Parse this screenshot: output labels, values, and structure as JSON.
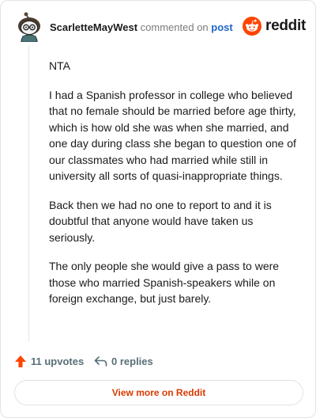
{
  "header": {
    "author": "ScarletteMayWest",
    "commented_text": "commented on",
    "post_link": "post",
    "logo_text": "reddit"
  },
  "comment": {
    "paragraphs": [
      "NTA",
      "I had a Spanish professor in college who believed that no female should be married before age thirty, which is how old she was when she married, and one day during class she began to question one of our classmates who had married while still in university all sorts of quasi-inappropriate things.",
      "Back then we had no one to report to and it is doubtful that anyone would have taken us seriously.",
      "The only people she would give a pass to were those who married Spanish-speakers while on foreign exchange, but just barely."
    ]
  },
  "actions": {
    "upvotes": "11 upvotes",
    "replies": "0 replies"
  },
  "footer": {
    "view_more": "View more on Reddit"
  },
  "colors": {
    "reddit_orange": "#ff4500",
    "link_blue": "#1f67c7",
    "view_more_text": "#d93a00",
    "meta_gray": "#576f76"
  },
  "icons": {
    "avatar": "snoo-avatar",
    "logo": "reddit-snoo-icon",
    "upvote": "upvote-arrow-icon",
    "reply": "reply-arrow-icon"
  }
}
